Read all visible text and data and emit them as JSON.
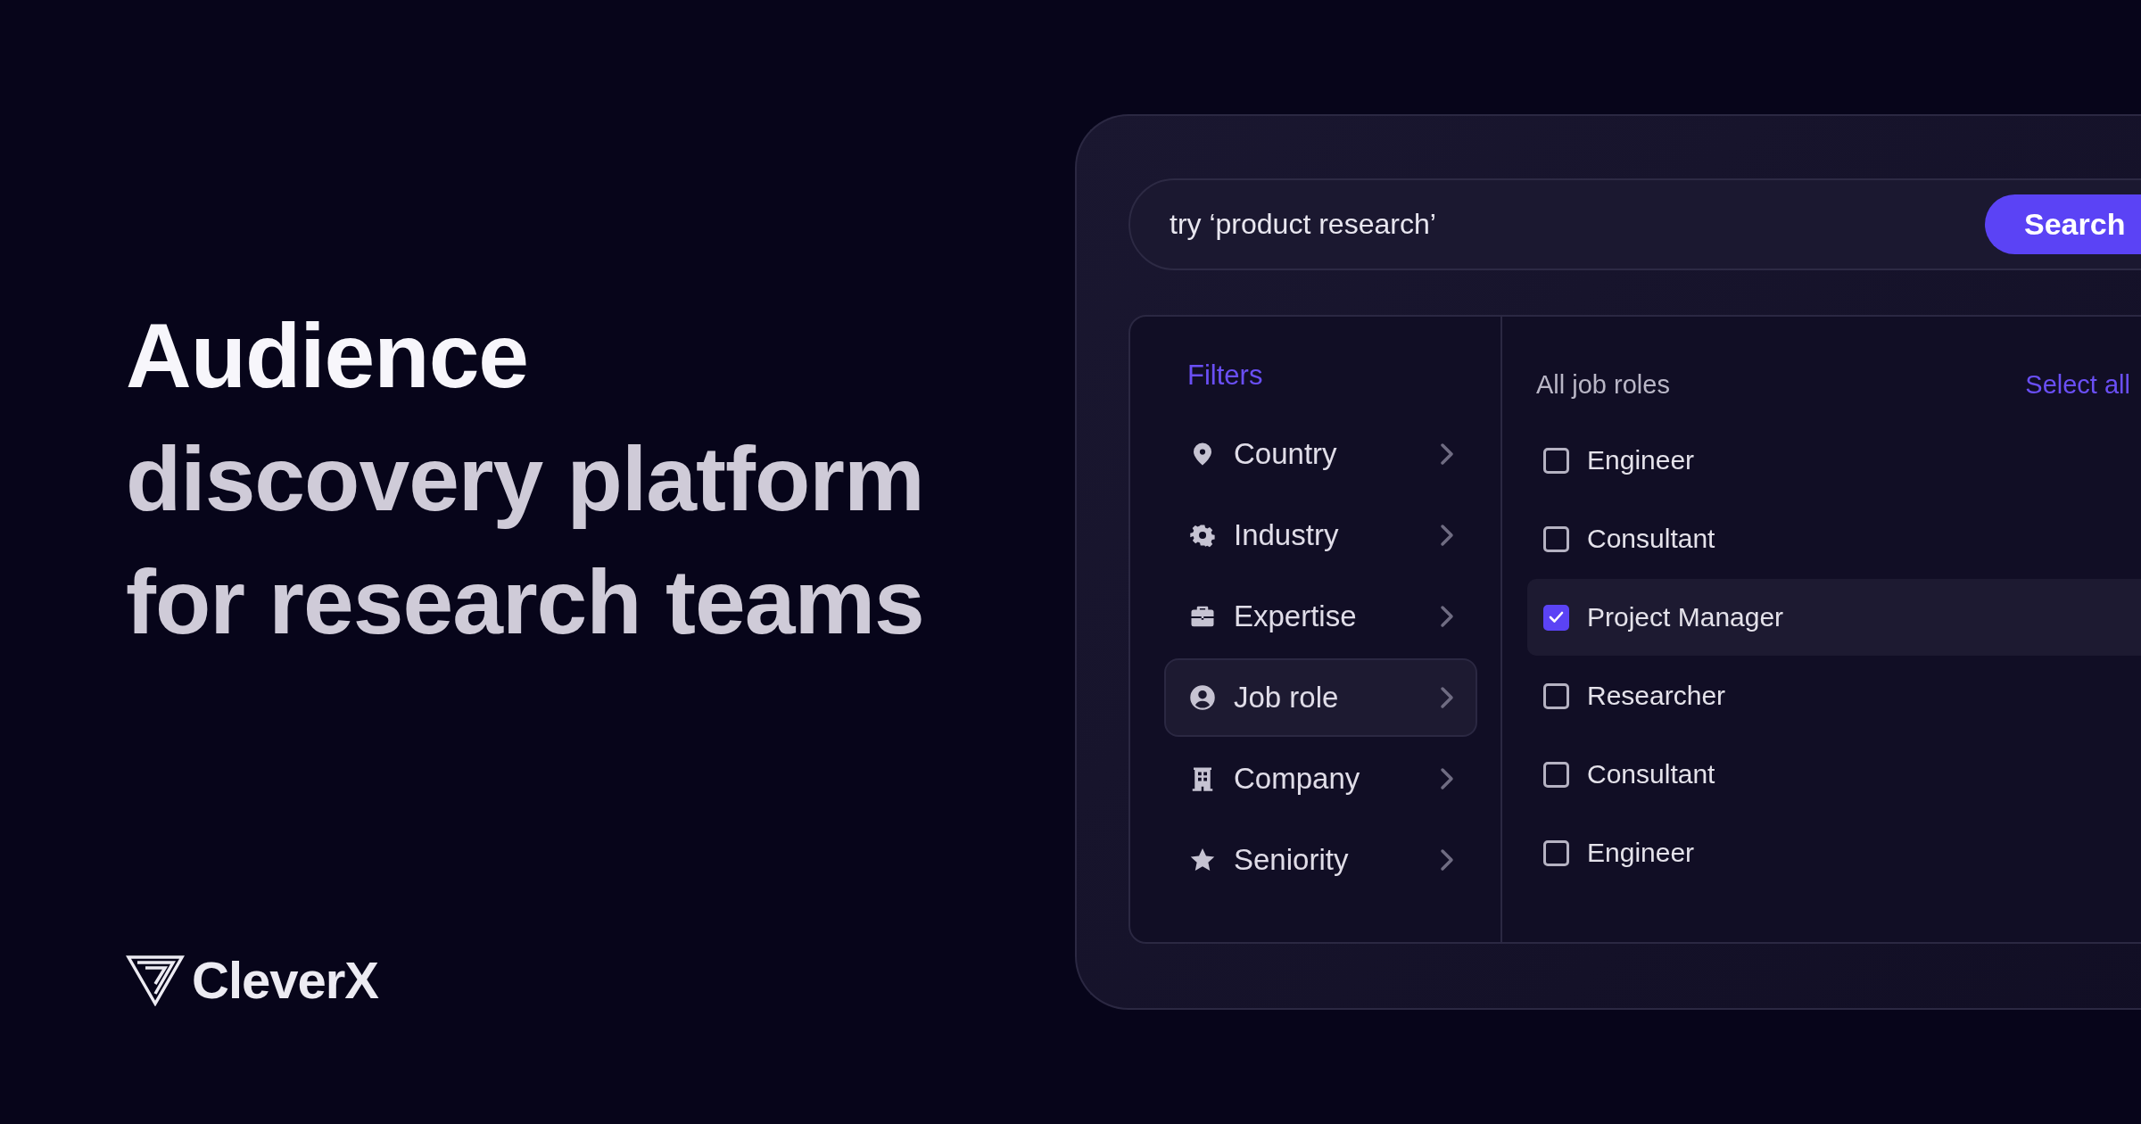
{
  "headline": [
    {
      "text": "Audience",
      "highlight": true
    },
    {
      "text": "discovery platform",
      "highlight": false
    },
    {
      "text": "for research teams",
      "highlight": false
    }
  ],
  "logo": {
    "text": "CleverX"
  },
  "search": {
    "placeholder": "try ‘product research’",
    "button": "Search"
  },
  "filters": {
    "title": "Filters",
    "items": [
      {
        "label": "Country",
        "selected": false
      },
      {
        "label": "Industry",
        "selected": false
      },
      {
        "label": "Expertise",
        "selected": false
      },
      {
        "label": "Job role",
        "selected": true
      },
      {
        "label": "Company",
        "selected": false
      },
      {
        "label": "Seniority",
        "selected": false
      }
    ]
  },
  "options": {
    "title": "All job roles",
    "select_all": "Select all",
    "items": [
      {
        "label": "Engineer",
        "checked": false
      },
      {
        "label": "Consultant",
        "checked": false
      },
      {
        "label": "Project Manager",
        "checked": true
      },
      {
        "label": "Researcher",
        "checked": false
      },
      {
        "label": "Consultant",
        "checked": false
      },
      {
        "label": "Engineer",
        "checked": false
      }
    ]
  }
}
